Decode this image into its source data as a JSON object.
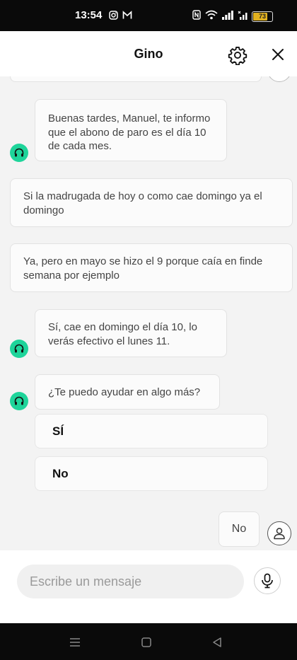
{
  "status_bar": {
    "time": "13:54",
    "left_icons": [
      "instagram-icon",
      "gmail-icon"
    ],
    "right_icons": [
      "nfc-icon",
      "wifi-icon",
      "signal-icon",
      "signal-x-icon",
      "battery-icon"
    ],
    "battery_level": "73",
    "battery_color": "#e0b020"
  },
  "header": {
    "title": "Gino"
  },
  "messages": [
    {
      "from": "bot",
      "text": "Buenas tardes, Manuel, te informo que el abono de paro es el día 10 de cada mes."
    },
    {
      "from": "user",
      "text": "Si la madrugada de hoy o como cae domingo ya el domingo"
    },
    {
      "from": "user",
      "text": "Ya, pero en mayo se hizo el 9 porque caía en finde semana por ejemplo"
    },
    {
      "from": "bot",
      "text": "Sí, cae en domingo el día 10, lo verás efectivo el lunes 11."
    },
    {
      "from": "bot",
      "text": "¿Te puedo ayudar en algo más?"
    }
  ],
  "quick_replies": [
    "SÍ",
    "No"
  ],
  "last_user_reply": "No",
  "composer": {
    "placeholder": "Escribe un mensaje"
  },
  "colors": {
    "bot_avatar": "#1ed49a",
    "background": "#f3f3f3"
  }
}
